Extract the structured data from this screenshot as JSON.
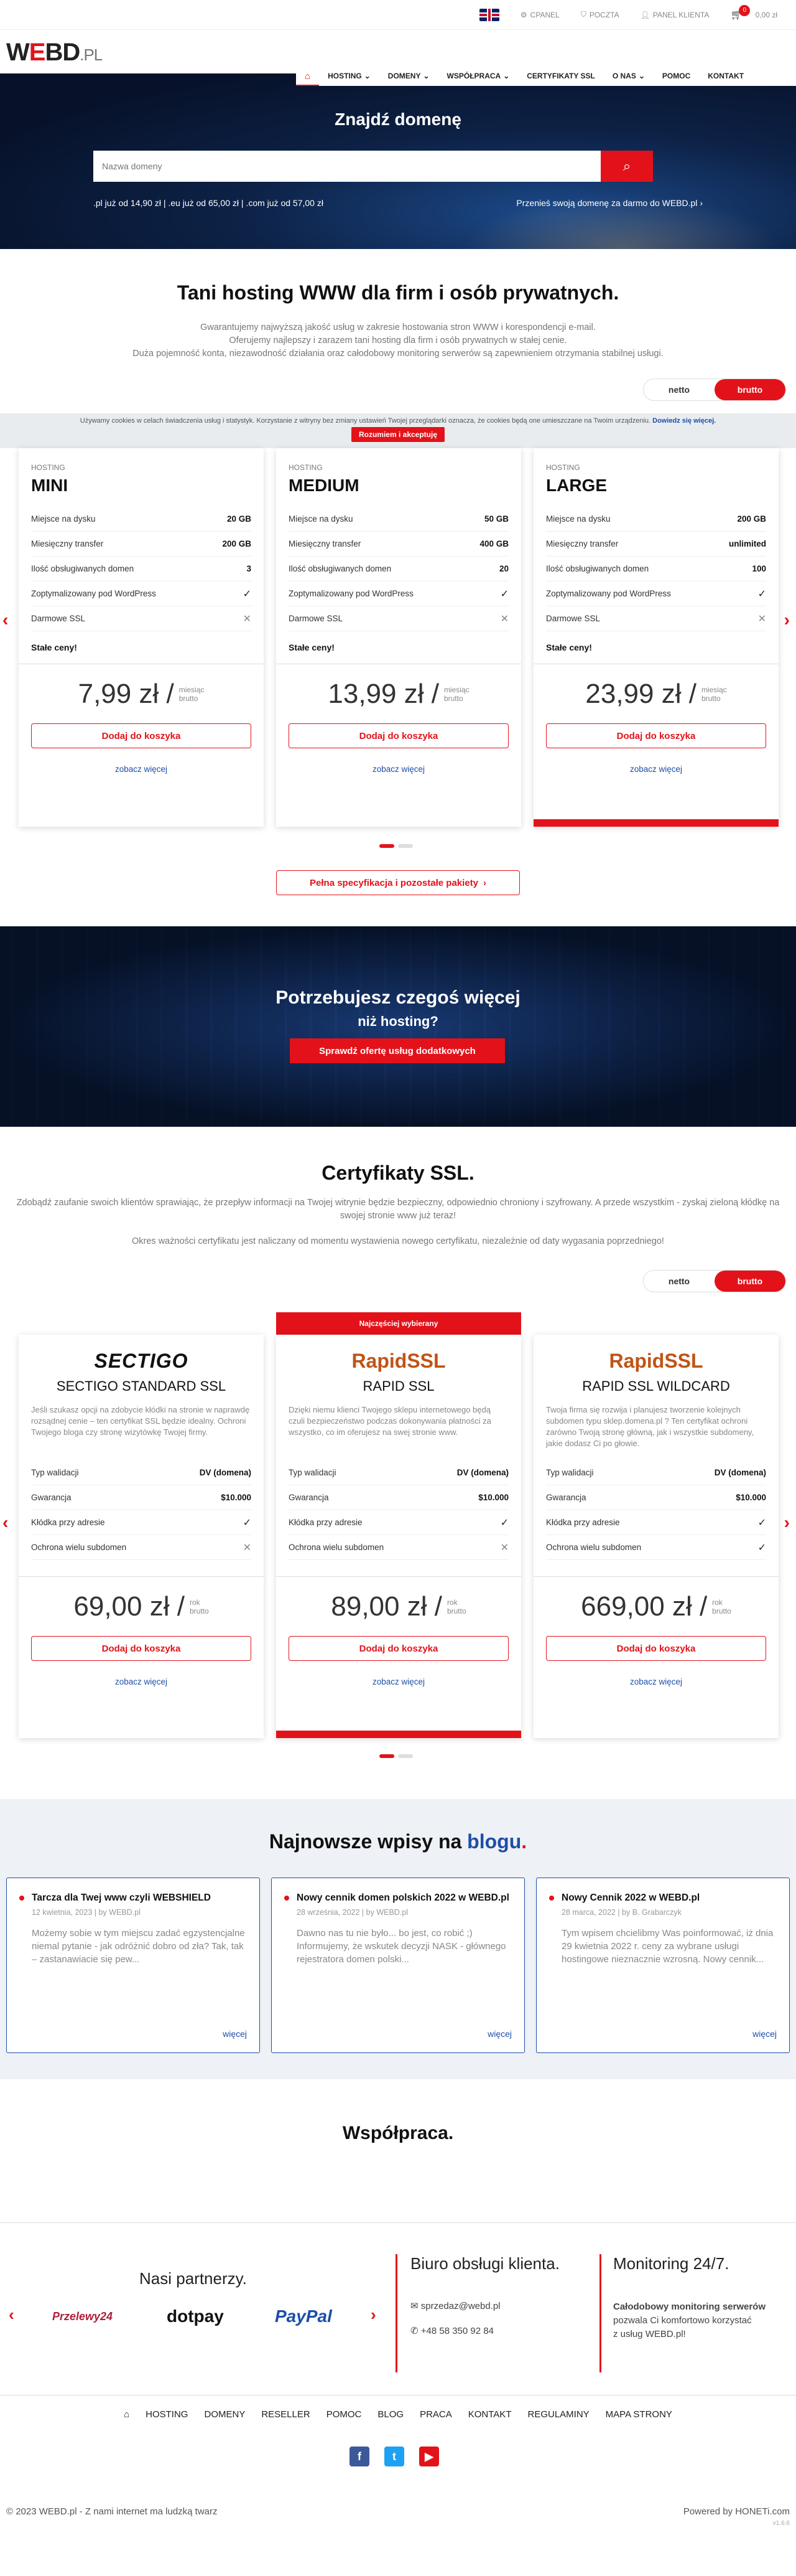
{
  "topbar": {
    "cpanel": "CPANEL",
    "poczta": "POCZTA",
    "panel": "PANEL KLIENTA",
    "cart_count": "0",
    "cart_total": "0,00 zł"
  },
  "logo": {
    "part1": "W",
    "part2": "E",
    "part3": "BD",
    "part4": ".PL"
  },
  "nav": {
    "items": [
      "HOSTING",
      "DOMENY",
      "WSPÓŁPRACA",
      "CERTYFIKATY SSL",
      "O NAS",
      "POMOC",
      "KONTAKT"
    ],
    "home_icon": "home-icon"
  },
  "hero": {
    "title": "Znajdź domenę",
    "search_placeholder": "Nazwa domeny",
    "prices": ".pl już od 14,90 zł | .eu już od 65,00 zł | .com już od 57,00 zł",
    "transfer": "Przenieś swoją domenę za darmo do WEBD.pl"
  },
  "hosting": {
    "title": "Tani hosting WWW dla firm i osób prywatnych.",
    "lead1": "Gwarantujemy najwyższą jakość usług w zakresie hostowania stron WWW i korespondencji e-mail.",
    "lead2": "Oferujemy najlepszy i zarazem tani hosting dla firm i osób prywatnych w stałej cenie.",
    "lead3": "Duża pojemność konta, niezawodność działania oraz całodobowy monitoring serwerów są zapewnieniem otrzymania stabilnej usługi.",
    "toggle_netto": "netto",
    "toggle_brutto": "brutto",
    "packages": [
      {
        "kind": "HOSTING",
        "name": "MINI",
        "disk": "20 GB",
        "transfer": "200 GB",
        "domains": "3",
        "price": "7,99 zł /"
      },
      {
        "kind": "HOSTING",
        "name": "MEDIUM",
        "disk": "50 GB",
        "transfer": "400 GB",
        "domains": "20",
        "price": "13,99 zł /"
      },
      {
        "kind": "HOSTING",
        "name": "LARGE",
        "disk": "200 GB",
        "transfer": "unlimited",
        "domains": "100",
        "price": "23,99 zł /"
      }
    ],
    "labels": {
      "disk": "Miejsce na dysku",
      "transfer": "Miesięczny transfer",
      "domains": "Ilość obsługiwanych domen",
      "wp": "Zoptymalizowany pod WordPress",
      "ssl": "Darmowe SSL",
      "fixed": "Stałe ceny!",
      "per1": "miesiąc",
      "per2": "brutto",
      "add": "Dodaj do koszyka",
      "more": "zobacz więcej"
    },
    "spec_button": "Pełna specyfikacja i pozostałe pakiety"
  },
  "cookie": {
    "text": "Używamy cookies w celach świadczenia usług i statystyk. Korzystanie z witryny bez zmiany ustawień Twojej przeglądarki oznacza, że cookies będą one umieszczane na Twoim urządzeniu.",
    "link": "Dowiedz się więcej.",
    "button": "Rozumiem i akceptuję"
  },
  "band": {
    "title": "Potrzebujesz czegoś więcej",
    "subtitle": "niż hosting?",
    "button": "Sprawdź ofertę usług dodatkowych"
  },
  "ssl": {
    "title": "Certyfikaty SSL.",
    "lead1": "Zdobądź zaufanie swoich klientów sprawiając, że przepływ informacji na Twojej witrynie będzie bezpieczny, odpowiednio chroniony i szyfrowany. A przede wszystkim - zyskaj zieloną kłódkę na swojej stronie www już teraz!",
    "lead2": "Okres ważności certyfikatu jest naliczany od momentu wystawienia nowego certyfikatu, niezależnie od daty wygasania poprzedniego!",
    "most_chosen": "Najczęściej wybierany",
    "labels": {
      "validation": "Typ walidacji",
      "warranty": "Gwarancja",
      "padlock": "Kłódka przy adresie",
      "subdomains": "Ochrona wielu subdomen",
      "per1": "rok",
      "per2": "brutto"
    },
    "products": [
      {
        "brand": "SECTIGO",
        "name": "SECTIGO STANDARD SSL",
        "desc": "Jeśli szukasz opcji na zdobycie kłódki na stronie w naprawdę rozsądnej cenie – ten certyfikat SSL będzie idealny. Ochroni Twojego bloga czy stronę wizytówkę Twojej firmy.",
        "validation": "DV (domena)",
        "warranty": "$10.000",
        "price": "69,00 zł /"
      },
      {
        "brand": "RapidSSL",
        "name": "RAPID SSL",
        "desc": "Dzięki niemu klienci Twojego sklepu internetowego będą czuli bezpieczeństwo podczas dokonywania płatności za wszystko, co im oferujesz na swej stronie www.",
        "validation": "DV (domena)",
        "warranty": "$10.000",
        "price": "89,00 zł /"
      },
      {
        "brand": "RapidSSL",
        "name": "RAPID SSL WILDCARD",
        "desc": "Twoja firma się rozwija i planujesz tworzenie kolejnych subdomen typu sklep.domena.pl ? Ten certyfikat ochroni zarówno Twoją stronę główną, jak i wszystkie subdomeny, jakie dodasz Ci po głowie.",
        "validation": "DV (domena)",
        "warranty": "$10.000",
        "price": "669,00 zł /"
      }
    ]
  },
  "blog": {
    "title_a": "Najnowsze wpisy na ",
    "title_b": "blogu",
    "title_c": ".",
    "posts": [
      {
        "title": "Tarcza dla Twej www czyli WEBSHIELD",
        "date": "12 kwietnia, 2023 | by WEBD.pl",
        "excerpt": "Możemy sobie w tym miejscu zadać egzystencjalne niemal pytanie - jak odróżnić dobro od zła? Tak, tak – zastanawiacie się pew...",
        "more": "więcej"
      },
      {
        "title": "Nowy cennik domen polskich 2022 w WEBD.pl",
        "date": "28 września, 2022 | by WEBD.pl",
        "excerpt": "Dawno nas tu nie było... bo jest, co robić ;) Informujemy, że wskutek decyzji NASK - głównego rejestratora domen polski...",
        "more": "więcej"
      },
      {
        "title": "Nowy Cennik 2022 w WEBD.pl",
        "date": "28 marca, 2022 | by B. Grabarczyk",
        "excerpt": "Tym wpisem chcielibmy Was poinformować, iż dnia 29 kwietnia 2022 r. ceny za wybrane usługi hostingowe nieznacznie wzrosną. Nowy cennik...",
        "more": "więcej"
      }
    ]
  },
  "coop": {
    "title": "Współpraca."
  },
  "footer": {
    "partners_title": "Nasi partnerzy.",
    "partners": [
      "Przelewy24",
      "dotpay",
      "PayPal"
    ],
    "office_title": "Biuro obsługi klienta.",
    "email": "sprzedaz@webd.pl",
    "phone": "+48 58 350 92 84",
    "monitoring_title": "Monitoring 24/7.",
    "monitoring_text1": "Całodobowy monitoring serwerów",
    "monitoring_text2": "pozwala Ci komfortowo korzystać",
    "monitoring_text3": "z usług WEBD.pl!",
    "nav": [
      "HOSTING",
      "DOMENY",
      "RESELLER",
      "POMOC",
      "BLOG",
      "PRACA",
      "KONTAKT",
      "REGULAMINY",
      "MAPA STRONY"
    ],
    "copyright": "© 2023 WEBD.pl - Z nami internet ma ludzką twarz",
    "powered": "Powered by HONETi.com",
    "version": "v1.6.6"
  },
  "colors": {
    "accent": "#e3121a",
    "link": "#1d4ea8"
  }
}
